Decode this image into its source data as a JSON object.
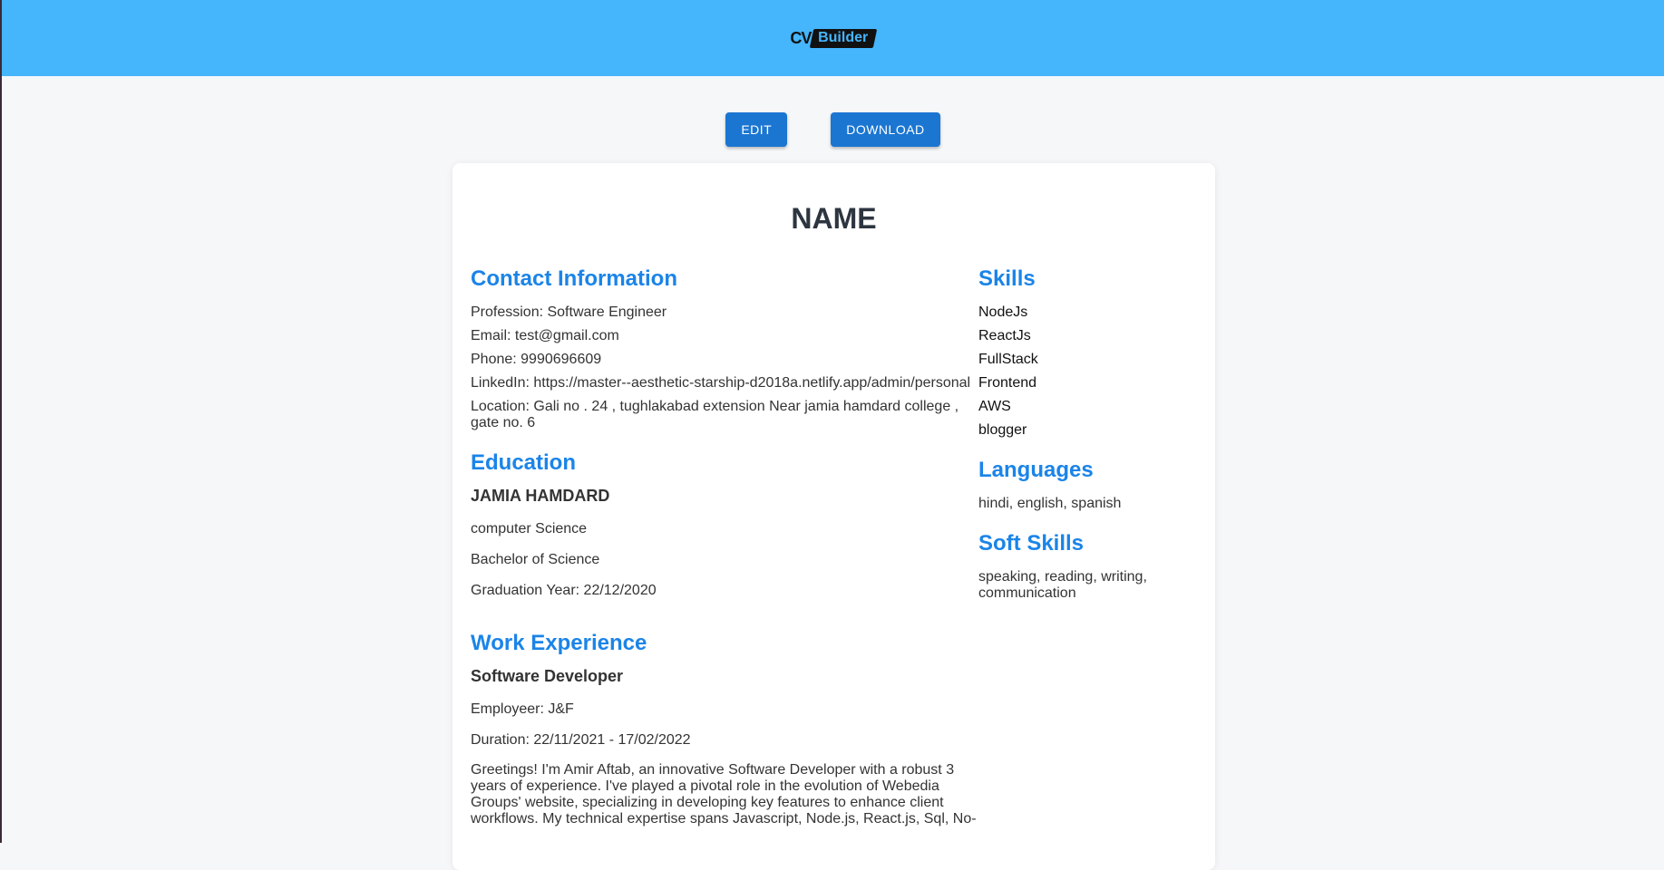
{
  "header": {
    "logo_cv": "CV",
    "logo_builder": "Builder"
  },
  "actions": {
    "edit_label": "EDIT",
    "download_label": "DOWNLOAD"
  },
  "cv": {
    "name": "NAME",
    "contact": {
      "heading": "Contact Information",
      "profession": "Profession: Software Engineer",
      "email": "Email: test@gmail.com",
      "phone": "Phone: 9990696609",
      "linkedin": "LinkedIn: https://master--aesthetic-starship-d2018a.netlify.app/admin/personal",
      "location": "Location: Gali no . 24 , tughlakabad extension Near jamia hamdard college , gate no. 6"
    },
    "education": {
      "heading": "Education",
      "institution": "JAMIA HAMDARD",
      "field": "computer Science",
      "degree": "Bachelor of Science",
      "graduation": "Graduation Year: 22/12/2020"
    },
    "work": {
      "heading": "Work Experience",
      "title": "Software Developer",
      "employer": "Employeer: J&F",
      "duration": "Duration: 22/11/2021 - 17/02/2022",
      "description": "Greetings! I'm Amir Aftab, an innovative Software Developer with a robust 3 years of experience. I've played a pivotal role in the evolution of Webedia Groups' website, specializing in developing key features to enhance client workflows. My technical expertise spans Javascript, Node.js, React.js, Sql, No-"
    },
    "skills": {
      "heading": "Skills",
      "items": [
        "NodeJs",
        "ReactJs",
        "FullStack",
        "Frontend",
        "AWS",
        "blogger"
      ]
    },
    "languages": {
      "heading": "Languages",
      "value": "hindi, english, spanish"
    },
    "soft_skills": {
      "heading": "Soft Skills",
      "value": "speaking, reading, writing, communication"
    }
  },
  "colors": {
    "topbar": "#45b5fc",
    "button": "#1b76d2",
    "heading": "#1b84e8"
  }
}
